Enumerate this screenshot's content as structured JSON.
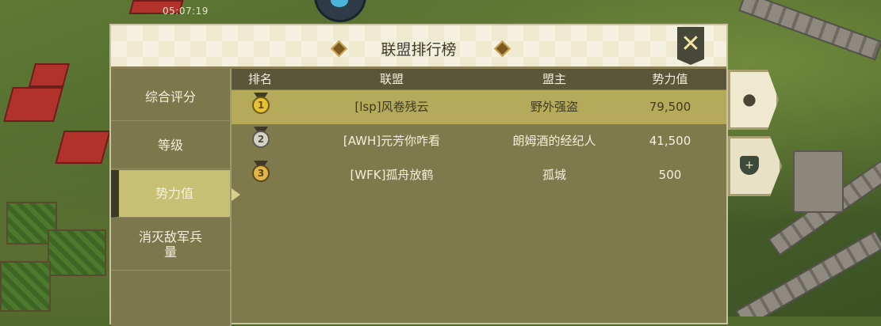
{
  "hud": {
    "timer": "05:07:19"
  },
  "dialog": {
    "title": "联盟排行榜",
    "close_icon": "close-icon",
    "tabs": [
      {
        "label": "综合评分",
        "active": false
      },
      {
        "label": "等级",
        "active": false
      },
      {
        "label": "势力值",
        "active": true
      },
      {
        "label": "消灭敌军兵量",
        "active": false
      }
    ],
    "table": {
      "headers": {
        "rank": "排名",
        "alliance": "联盟",
        "leader": "盟主",
        "power": "势力值"
      },
      "rows": [
        {
          "rank": "1",
          "medal": "gold-medal-icon",
          "alliance": "[lsp]风卷残云",
          "leader": "野外强盗",
          "power": "79,500",
          "highlighted": true
        },
        {
          "rank": "2",
          "medal": "silver-medal-icon",
          "alliance": "[AWH]元芳你咋看",
          "leader": "朗姆酒的经纪人",
          "power": "41,500",
          "highlighted": false
        },
        {
          "rank": "3",
          "medal": "bronze-medal-icon",
          "alliance": "[WFK]孤舟放鹤",
          "leader": "孤城",
          "power": "500",
          "highlighted": false
        }
      ]
    }
  },
  "side_buttons": [
    {
      "icon": "profile-icon"
    },
    {
      "icon": "alliance-shield-icon"
    }
  ],
  "colors": {
    "dialog_bg": "#7f7a4c",
    "highlight_row": "#b5a95a",
    "active_tab": "#c7bf73",
    "title_bar": "#efe9cf"
  }
}
